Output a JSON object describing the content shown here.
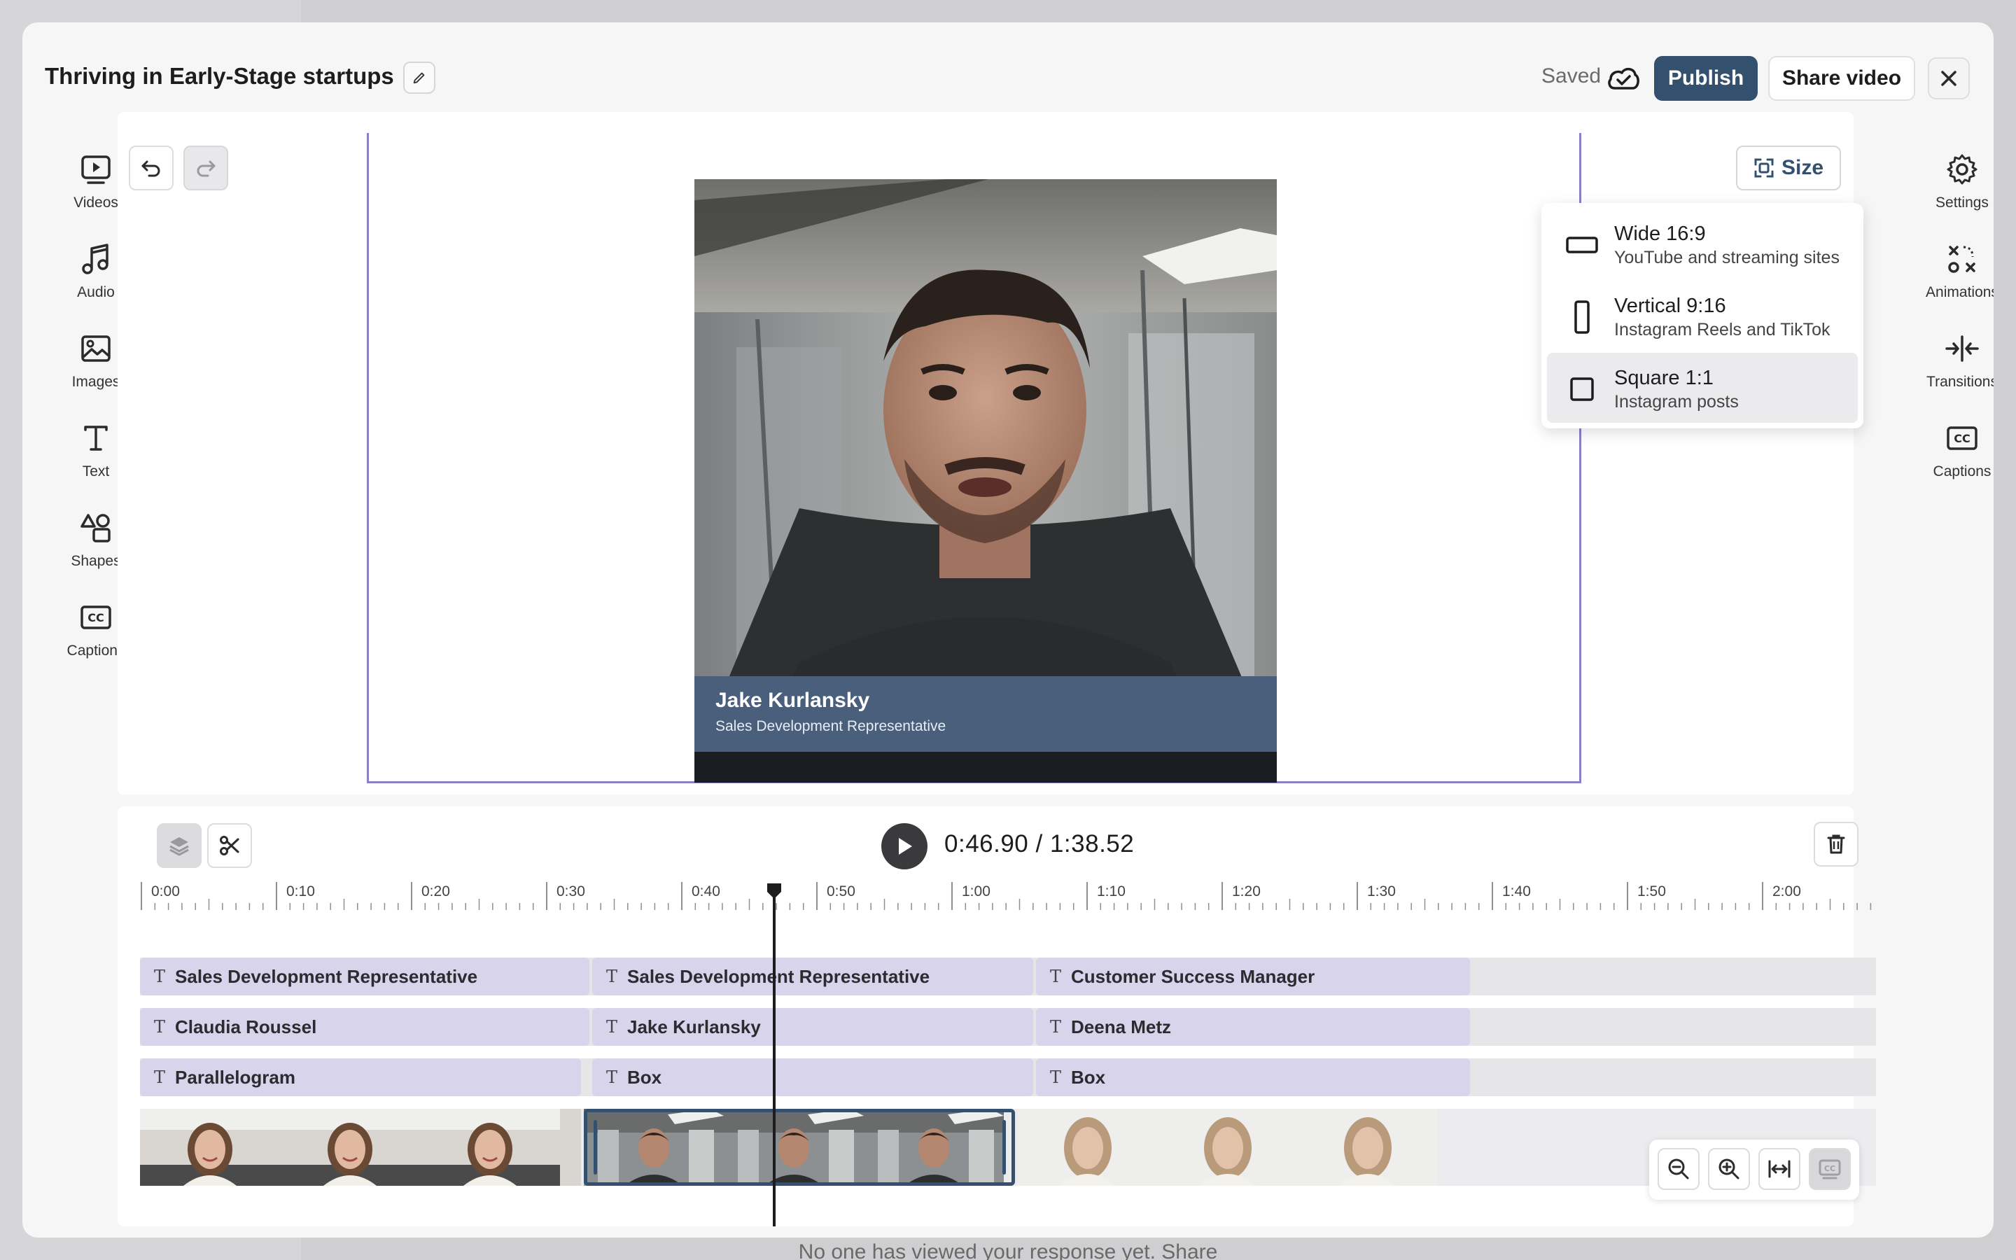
{
  "background": {
    "footer_text": "No one has viewed your response yet. Share"
  },
  "header": {
    "title": "Thriving in Early-Stage startups",
    "saved_label": "Saved",
    "publish_label": "Publish",
    "share_label": "Share video"
  },
  "left_toolbar": [
    {
      "label": "Videos",
      "icon": "videos-icon"
    },
    {
      "label": "Audio",
      "icon": "audio-icon"
    },
    {
      "label": "Images",
      "icon": "images-icon"
    },
    {
      "label": "Text",
      "icon": "text-icon"
    },
    {
      "label": "Shapes",
      "icon": "shapes-icon"
    },
    {
      "label": "Captions",
      "icon": "captions-icon"
    }
  ],
  "right_toolbar": [
    {
      "label": "Settings",
      "icon": "gear-icon"
    },
    {
      "label": "Animations",
      "icon": "animations-icon"
    },
    {
      "label": "Transitions",
      "icon": "transitions-icon"
    },
    {
      "label": "Captions",
      "icon": "captions-icon"
    }
  ],
  "canvas": {
    "size_label": "Size",
    "lower_third": {
      "name": "Jake Kurlansky",
      "role": "Sales Development Representative"
    }
  },
  "size_menu": [
    {
      "title": "Wide 16:9",
      "subtitle": "YouTube and streaming sites",
      "icon": "wide-rect-icon",
      "selected": false
    },
    {
      "title": "Vertical 9:16",
      "subtitle": "Instagram Reels and TikTok",
      "icon": "vertical-rect-icon",
      "selected": false
    },
    {
      "title": "Square 1:1",
      "subtitle": "Instagram posts",
      "icon": "square-icon",
      "selected": true
    }
  ],
  "player": {
    "timecode": "0:46.90 / 1:38.52"
  },
  "ruler_labels": [
    "0:00",
    "0:10",
    "0:20",
    "0:30",
    "0:40",
    "0:50",
    "1:00",
    "1:10",
    "1:20",
    "1:30",
    "1:40",
    "1:50",
    "2:00"
  ],
  "tracks": [
    [
      "Sales Development Representative",
      "Sales Development Representative",
      "Customer Success Manager"
    ],
    [
      "Claudia Roussel",
      "Jake Kurlansky",
      "Deena Metz"
    ],
    [
      "Parallelogram",
      "Box",
      "Box"
    ]
  ],
  "colors": {
    "accent": "#34506f",
    "frame": "#8b80c6",
    "text_clip": "#d8d4ec"
  }
}
